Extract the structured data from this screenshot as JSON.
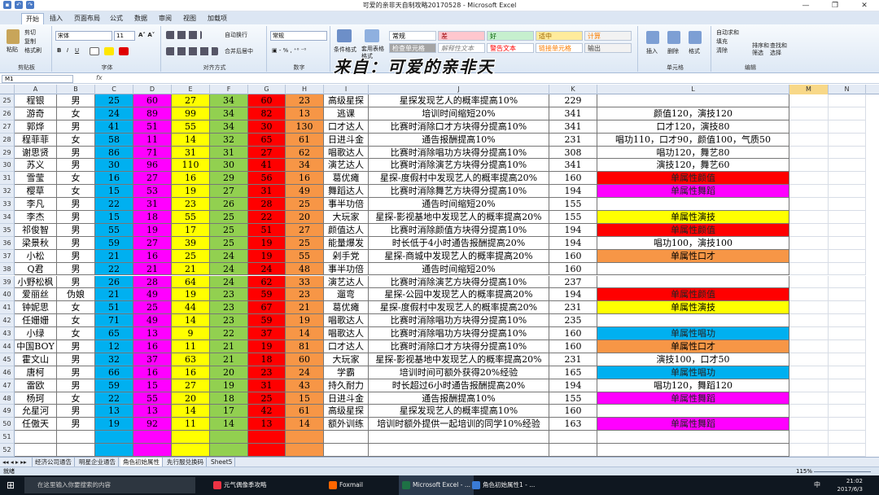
{
  "window": {
    "title": "可爱的亲非天自制攻略20170528 - Microsoft Excel"
  },
  "tabs": [
    "开始",
    "插入",
    "页面布局",
    "公式",
    "数据",
    "审阅",
    "视图",
    "加载项"
  ],
  "ribbon": {
    "clipboard": {
      "label": "剪贴板",
      "paste": "粘贴",
      "cut": "剪切",
      "copy": "复制",
      "format_painter": "格式刷"
    },
    "font": {
      "label": "字体",
      "name": "宋体",
      "size": "11"
    },
    "alignment": {
      "label": "对齐方式",
      "wrap": "自动换行",
      "merge": "合并后居中"
    },
    "number": {
      "label": "数字",
      "format": "常规"
    },
    "styles": {
      "label": "样式",
      "conditional": "条件格式",
      "table_format": "套用表格格式",
      "cell_styles": [
        "常规",
        "差",
        "好",
        "适中",
        "计算",
        "检查单元格",
        "解释性文本",
        "警告文本",
        "链接单元格",
        "输出"
      ]
    },
    "cells": {
      "label": "单元格",
      "insert": "插入",
      "delete": "删除",
      "format": "格式"
    },
    "editing": {
      "label": "编辑",
      "autosum": "自动求和",
      "fill": "填充",
      "clear": "清除",
      "sort": "排序和筛选",
      "find": "查找和选择"
    }
  },
  "watermark": "来自：可爱的亲非天",
  "formula_bar": {
    "name_box": "M1",
    "fx": "fx"
  },
  "columns": [
    "A",
    "B",
    "C",
    "D",
    "E",
    "F",
    "G",
    "H",
    "I",
    "J",
    "K",
    "L",
    "M",
    "N"
  ],
  "colors": {
    "C": "#00b0f0",
    "D": "#ff00ff",
    "E": "#ffff00",
    "F": "#92d050",
    "G": "#ff0000",
    "H": "#f79646",
    "red": "#ff0000",
    "magenta": "#ff00ff",
    "yellow": "#ffff00",
    "orange": "#f79646",
    "blue": "#00b0f0"
  },
  "rows": [
    {
      "n": "25",
      "name": "程银",
      "sex": "男",
      "v": [
        "25",
        "60",
        "27",
        "34",
        "60",
        "23"
      ],
      "title": "高级星探",
      "effect": "星探发现艺人的概率提高10%",
      "k": "229",
      "note": "",
      "nc": ""
    },
    {
      "n": "26",
      "name": "游奇",
      "sex": "女",
      "v": [
        "24",
        "89",
        "99",
        "34",
        "82",
        "13"
      ],
      "title": "逃课",
      "effect": "培训时间缩短20%",
      "k": "341",
      "note": "颜值120，演技120",
      "nc": ""
    },
    {
      "n": "27",
      "name": "郭烨",
      "sex": "男",
      "v": [
        "41",
        "51",
        "55",
        "34",
        "30",
        "130"
      ],
      "title": "口才达人",
      "effect": "比赛时消除口才方块得分提高10%",
      "k": "341",
      "note": "口才120，演技80",
      "nc": ""
    },
    {
      "n": "28",
      "name": "程菲菲",
      "sex": "女",
      "v": [
        "58",
        "11",
        "14",
        "32",
        "65",
        "61"
      ],
      "title": "日进斗金",
      "effect": "通告报酬提高10%",
      "k": "231",
      "note": "唱功110，口才90，颜值100，气质50",
      "nc": ""
    },
    {
      "n": "29",
      "name": "谢思贤",
      "sex": "男",
      "v": [
        "86",
        "71",
        "31",
        "31",
        "27",
        "62"
      ],
      "title": "唱歌达人",
      "effect": "比赛时消除唱功方块得分提高10%",
      "k": "308",
      "note": "唱功120，舞艺80",
      "nc": ""
    },
    {
      "n": "30",
      "name": "苏义",
      "sex": "男",
      "v": [
        "30",
        "96",
        "110",
        "30",
        "41",
        "34"
      ],
      "title": "演艺达人",
      "effect": "比赛时消除演艺方块得分提高10%",
      "k": "341",
      "note": "演技120，舞艺60",
      "nc": ""
    },
    {
      "n": "31",
      "name": "雪莹",
      "sex": "女",
      "v": [
        "16",
        "27",
        "16",
        "29",
        "56",
        "16"
      ],
      "title": "葛优瘫",
      "effect": "星探-度假村中发现艺人的概率提高20%",
      "k": "160",
      "note": "单属性颜值",
      "nc": "red"
    },
    {
      "n": "32",
      "name": "樱草",
      "sex": "女",
      "v": [
        "15",
        "53",
        "19",
        "27",
        "31",
        "49"
      ],
      "title": "舞蹈达人",
      "effect": "比赛时消除舞艺方块得分提高10%",
      "k": "194",
      "note": "单属性舞蹈",
      "nc": "magenta"
    },
    {
      "n": "33",
      "name": "李凡",
      "sex": "男",
      "v": [
        "22",
        "31",
        "23",
        "26",
        "28",
        "25"
      ],
      "title": "事半功倍",
      "effect": "通告时间缩短20%",
      "k": "155",
      "note": "",
      "nc": ""
    },
    {
      "n": "34",
      "name": "李杰",
      "sex": "男",
      "v": [
        "15",
        "18",
        "55",
        "25",
        "22",
        "20"
      ],
      "title": "大玩家",
      "effect": "星探-影视基地中发现艺人的概率提高20%",
      "k": "155",
      "note": "单属性演技",
      "nc": "yellow"
    },
    {
      "n": "35",
      "name": "祁俊智",
      "sex": "男",
      "v": [
        "55",
        "19",
        "17",
        "25",
        "51",
        "27"
      ],
      "title": "颜值达人",
      "effect": "比赛时消除颜值方块得分提高10%",
      "k": "194",
      "note": "单属性颜值",
      "nc": "red"
    },
    {
      "n": "36",
      "name": "梁景秋",
      "sex": "男",
      "v": [
        "59",
        "27",
        "39",
        "25",
        "19",
        "25"
      ],
      "title": "能量爆发",
      "effect": "时长低于4小时通告报酬提高20%",
      "k": "194",
      "note": "唱功100，演技100",
      "nc": ""
    },
    {
      "n": "37",
      "name": "小松",
      "sex": "男",
      "v": [
        "21",
        "16",
        "25",
        "24",
        "19",
        "55"
      ],
      "title": "剁手党",
      "effect": "星探-商城中发现艺人的概率提高20%",
      "k": "160",
      "note": "单属性口才",
      "nc": "orange"
    },
    {
      "n": "38",
      "name": "Q君",
      "sex": "男",
      "v": [
        "22",
        "21",
        "21",
        "24",
        "24",
        "48"
      ],
      "title": "事半功倍",
      "effect": "通告时间缩短20%",
      "k": "160",
      "note": "",
      "nc": ""
    },
    {
      "n": "39",
      "name": "小野松枫",
      "sex": "男",
      "v": [
        "26",
        "28",
        "64",
        "24",
        "62",
        "33"
      ],
      "title": "演艺达人",
      "effect": "比赛时消除演艺方块得分提高10%",
      "k": "237",
      "note": "",
      "nc": ""
    },
    {
      "n": "40",
      "name": "爱丽丝",
      "sex": "伪娘",
      "v": [
        "21",
        "49",
        "19",
        "23",
        "59",
        "23"
      ],
      "title": "遛弯",
      "effect": "星探-公园中发现艺人的概率提高20%",
      "k": "194",
      "note": "单属性颜值",
      "nc": "red"
    },
    {
      "n": "41",
      "name": "钟妮思",
      "sex": "女",
      "v": [
        "51",
        "25",
        "44",
        "23",
        "67",
        "21"
      ],
      "title": "葛优瘫",
      "effect": "星探-度假村中发现艺人的概率提高20%",
      "k": "231",
      "note": "单属性演技",
      "nc": "yellow"
    },
    {
      "n": "42",
      "name": "任姗姗",
      "sex": "女",
      "v": [
        "71",
        "49",
        "14",
        "23",
        "59",
        "19"
      ],
      "title": "唱歌达人",
      "effect": "比赛时消除唱功方块得分提高10%",
      "k": "235",
      "note": "",
      "nc": ""
    },
    {
      "n": "43",
      "name": "小绿",
      "sex": "女",
      "v": [
        "65",
        "13",
        "9",
        "22",
        "37",
        "14"
      ],
      "title": "唱歌达人",
      "effect": "比赛时消除唱功方块得分提高10%",
      "k": "160",
      "note": "单属性唱功",
      "nc": "blue"
    },
    {
      "n": "44",
      "name": "中国BOY",
      "sex": "男",
      "v": [
        "12",
        "16",
        "11",
        "21",
        "19",
        "81"
      ],
      "title": "口才达人",
      "effect": "比赛时消除口才方块得分提高10%",
      "k": "160",
      "note": "单属性口才",
      "nc": "orange"
    },
    {
      "n": "45",
      "name": "霍文山",
      "sex": "男",
      "v": [
        "32",
        "37",
        "63",
        "21",
        "18",
        "60"
      ],
      "title": "大玩家",
      "effect": "星探-影视基地中发现艺人的概率提高20%",
      "k": "231",
      "note": "演技100，口才50",
      "nc": ""
    },
    {
      "n": "46",
      "name": "唐柯",
      "sex": "男",
      "v": [
        "66",
        "16",
        "16",
        "20",
        "23",
        "24"
      ],
      "title": "学霸",
      "effect": "培训时间可额外获得20%经验",
      "k": "165",
      "note": "单属性唱功",
      "nc": "blue"
    },
    {
      "n": "47",
      "name": "雷欧",
      "sex": "男",
      "v": [
        "59",
        "15",
        "27",
        "19",
        "31",
        "43"
      ],
      "title": "持久耐力",
      "effect": "时长超过6小时通告报酬提高20%",
      "k": "194",
      "note": "唱功120，舞蹈120",
      "nc": ""
    },
    {
      "n": "48",
      "name": "杨珂",
      "sex": "女",
      "v": [
        "22",
        "55",
        "20",
        "18",
        "25",
        "15"
      ],
      "title": "日进斗金",
      "effect": "通告报酬提高10%",
      "k": "155",
      "note": "单属性舞蹈",
      "nc": "magenta"
    },
    {
      "n": "49",
      "name": "允星河",
      "sex": "男",
      "v": [
        "13",
        "13",
        "14",
        "17",
        "42",
        "61"
      ],
      "title": "高级星探",
      "effect": "星探发现艺人的概率提高10%",
      "k": "160",
      "note": "",
      "nc": ""
    },
    {
      "n": "50",
      "name": "任傲天",
      "sex": "男",
      "v": [
        "19",
        "92",
        "11",
        "14",
        "13",
        "14"
      ],
      "title": "额外训练",
      "effect": "培训时额外提供一起培训的同学10%经验",
      "k": "163",
      "note": "单属性舞蹈",
      "nc": "magenta"
    },
    {
      "n": "51",
      "name": "",
      "sex": "",
      "v": [
        "",
        "",
        "",
        "",
        "",
        ""
      ],
      "title": "",
      "effect": "",
      "k": "",
      "note": "",
      "nc": ""
    },
    {
      "n": "52",
      "name": "",
      "sex": "",
      "v": [
        "",
        "",
        "",
        "",
        "",
        ""
      ],
      "title": "",
      "effect": "",
      "k": "",
      "note": "",
      "nc": ""
    }
  ],
  "sheet_tabs": [
    "经济公司通告",
    "明星企业通告",
    "角色初始属性",
    "先行服兑换码",
    "Sheet5"
  ],
  "status": {
    "ready": "就绪",
    "zoom": "115%"
  },
  "taskbar": {
    "search": "在这里输入你要搜索的内容",
    "items": [
      "元气偶像季攻略",
      "Foxmail",
      "Microsoft Excel - ...",
      "角色初始属性1 - ..."
    ],
    "time": "21:02",
    "date": "2017/6/3",
    "ime": "中"
  }
}
